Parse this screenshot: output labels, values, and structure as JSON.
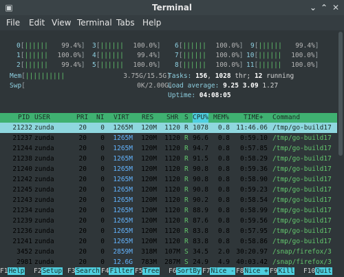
{
  "window": {
    "title": "Terminal"
  },
  "menu": [
    "File",
    "Edit",
    "View",
    "Terminal",
    "Tabs",
    "Help"
  ],
  "cpu_meters": [
    {
      "id": "0",
      "bar": "||||||",
      "pct": "99.4%"
    },
    {
      "id": "1",
      "bar": "||||||",
      "pct": "100.0%"
    },
    {
      "id": "2",
      "bar": "||||||",
      "pct": "99.4%"
    },
    {
      "id": "3",
      "bar": "||||||",
      "pct": "100.0%"
    },
    {
      "id": "4",
      "bar": "||||||",
      "pct": "99.4%"
    },
    {
      "id": "5",
      "bar": "||||||",
      "pct": "100.0%"
    },
    {
      "id": "6",
      "bar": "||||||",
      "pct": "100.0%"
    },
    {
      "id": "7",
      "bar": "||||||",
      "pct": "100.0%"
    },
    {
      "id": "8",
      "bar": "||||||",
      "pct": "100.0%"
    },
    {
      "id": "9",
      "bar": "||||||",
      "pct": "99.4%"
    },
    {
      "id": "10",
      "bar": "||||||",
      "pct": "100.0%"
    },
    {
      "id": "11",
      "bar": "||||||",
      "pct": "100.0%"
    }
  ],
  "mem": {
    "label": "Mem",
    "bar": "||||||||||",
    "value": "3.75G/15.5G"
  },
  "swp": {
    "label": "Swp",
    "value": "0K/2.00G"
  },
  "tasks": {
    "label": "Tasks:",
    "tasks": "156",
    "threads_sep": ",",
    "threads": "1028",
    "thr": "thr;",
    "running": "12",
    "running_label": "running"
  },
  "load": {
    "label": "Load average:",
    "l1": "9.25",
    "l5": "3.09",
    "l15": "1.27"
  },
  "uptime": {
    "label": "Uptime:",
    "value": "04:08:05"
  },
  "columns": [
    "PID",
    "USER",
    "PRI",
    "NI",
    "VIRT",
    "RES",
    "SHR",
    "S",
    "CPU%",
    "MEM%",
    "TIME+",
    "Command"
  ],
  "sort_column": "CPU%",
  "processes": [
    {
      "pid": "21232",
      "user": "zunda",
      "pri": "20",
      "ni": "0",
      "virt": "1265M",
      "res": "120M",
      "shr": "1120",
      "s": "R",
      "cpu": "1078",
      "mem": "0.8",
      "time": "11:46.06",
      "cmd": "/tmp/go-build17",
      "selected": true
    },
    {
      "pid": "21237",
      "user": "zunda",
      "pri": "20",
      "ni": "0",
      "virt": "1265M",
      "res": "120M",
      "shr": "1120",
      "s": "R",
      "cpu": "96.6",
      "mem": "0.8",
      "time": "0:59.10",
      "cmd": "/tmp/go-build17"
    },
    {
      "pid": "21244",
      "user": "zunda",
      "pri": "20",
      "ni": "0",
      "virt": "1265M",
      "res": "120M",
      "shr": "1120",
      "s": "R",
      "cpu": "94.7",
      "mem": "0.8",
      "time": "0:57.85",
      "cmd": "/tmp/go-build17"
    },
    {
      "pid": "21238",
      "user": "zunda",
      "pri": "20",
      "ni": "0",
      "virt": "1265M",
      "res": "120M",
      "shr": "1120",
      "s": "R",
      "cpu": "91.5",
      "mem": "0.8",
      "time": "0:58.29",
      "cmd": "/tmp/go-build17"
    },
    {
      "pid": "21240",
      "user": "zunda",
      "pri": "20",
      "ni": "0",
      "virt": "1265M",
      "res": "120M",
      "shr": "1120",
      "s": "R",
      "cpu": "90.8",
      "mem": "0.8",
      "time": "0:59.36",
      "cmd": "/tmp/go-build17"
    },
    {
      "pid": "21242",
      "user": "zunda",
      "pri": "20",
      "ni": "0",
      "virt": "1265M",
      "res": "120M",
      "shr": "1120",
      "s": "R",
      "cpu": "90.8",
      "mem": "0.8",
      "time": "0:58.90",
      "cmd": "/tmp/go-build17"
    },
    {
      "pid": "21245",
      "user": "zunda",
      "pri": "20",
      "ni": "0",
      "virt": "1265M",
      "res": "120M",
      "shr": "1120",
      "s": "R",
      "cpu": "90.8",
      "mem": "0.8",
      "time": "0:59.23",
      "cmd": "/tmp/go-build17"
    },
    {
      "pid": "21243",
      "user": "zunda",
      "pri": "20",
      "ni": "0",
      "virt": "1265M",
      "res": "120M",
      "shr": "1120",
      "s": "R",
      "cpu": "90.2",
      "mem": "0.8",
      "time": "0:58.54",
      "cmd": "/tmp/go-build17"
    },
    {
      "pid": "21234",
      "user": "zunda",
      "pri": "20",
      "ni": "0",
      "virt": "1265M",
      "res": "120M",
      "shr": "1120",
      "s": "R",
      "cpu": "88.9",
      "mem": "0.8",
      "time": "0:58.99",
      "cmd": "/tmp/go-build17"
    },
    {
      "pid": "21239",
      "user": "zunda",
      "pri": "20",
      "ni": "0",
      "virt": "1265M",
      "res": "120M",
      "shr": "1120",
      "s": "R",
      "cpu": "87.6",
      "mem": "0.8",
      "time": "0:59.56",
      "cmd": "/tmp/go-build17"
    },
    {
      "pid": "21236",
      "user": "zunda",
      "pri": "20",
      "ni": "0",
      "virt": "1265M",
      "res": "120M",
      "shr": "1120",
      "s": "R",
      "cpu": "83.8",
      "mem": "0.8",
      "time": "0:57.95",
      "cmd": "/tmp/go-build17"
    },
    {
      "pid": "21241",
      "user": "zunda",
      "pri": "20",
      "ni": "0",
      "virt": "1265M",
      "res": "120M",
      "shr": "1120",
      "s": "R",
      "cpu": "83.8",
      "mem": "0.8",
      "time": "0:58.86",
      "cmd": "/tmp/go-build17"
    },
    {
      "pid": "3452",
      "user": "zunda",
      "pri": "20",
      "ni": "0",
      "virt": "2859M",
      "res": "318M",
      "shr": "107M",
      "s": "S",
      "cpu": "34.5",
      "mem": "2.0",
      "time": "30:20.97",
      "cmd": "/snap/firefox/3"
    },
    {
      "pid": "2981",
      "user": "zunda",
      "pri": "20",
      "ni": "0",
      "virt": "12.6G",
      "res": "783M",
      "shr": "287M",
      "s": "S",
      "cpu": "24.9",
      "mem": "4.9",
      "time": "40:03.42",
      "cmd": "/snap/firefox/3"
    }
  ],
  "function_keys": [
    {
      "key": "F1",
      "label": "Help"
    },
    {
      "key": "F2",
      "label": "Setup"
    },
    {
      "key": "F3",
      "label": "Search"
    },
    {
      "key": "F4",
      "label": "Filter"
    },
    {
      "key": "F5",
      "label": "Tree"
    },
    {
      "key": "F6",
      "label": "SortBy"
    },
    {
      "key": "F7",
      "label": "Nice -"
    },
    {
      "key": "F8",
      "label": "Nice +"
    },
    {
      "key": "F9",
      "label": "Kill"
    },
    {
      "key": "F10",
      "label": "Quit"
    }
  ],
  "colors": {
    "accent": "#3fb171",
    "selection": "#8fd7df",
    "sort_highlight": "#4fcfe0",
    "bar": "#63c76d"
  }
}
